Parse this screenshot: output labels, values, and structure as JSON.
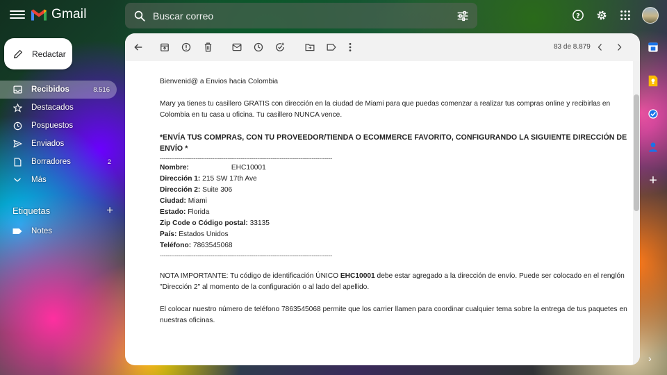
{
  "app": {
    "name": "Gmail"
  },
  "search": {
    "placeholder": "Buscar correo"
  },
  "compose": {
    "label": "Redactar"
  },
  "nav": [
    {
      "label": "Recibidos",
      "count": "8.516",
      "icon": "inbox-icon"
    },
    {
      "label": "Destacados",
      "count": "",
      "icon": "star-icon"
    },
    {
      "label": "Pospuestos",
      "count": "",
      "icon": "clock-icon"
    },
    {
      "label": "Enviados",
      "count": "",
      "icon": "send-icon"
    },
    {
      "label": "Borradores",
      "count": "2",
      "icon": "draft-icon"
    },
    {
      "label": "Más",
      "count": "",
      "icon": "chevron-down-icon"
    }
  ],
  "labels": {
    "title": "Etiquetas",
    "items": [
      {
        "label": "Notes"
      }
    ]
  },
  "toolbar": {
    "pager": "83 de 8.879"
  },
  "email": {
    "greeting": "Bienvenid@ a Envios hacia Colombia",
    "intro": "Mary ya tienes tu casillero GRATIS con dirección en la ciudad de Miami para que puedas comenzar a realizar tus compras online y recibirlas en Colombia en tu casa u oficina. Tu casillero NUNCA vence.",
    "headline": "*ENVÍA TUS COMPRAS, CON TU PROVEEDOR/TIENDA O ECOMMERCE FAVORITO, CONFIGURANDO LA SIGUIENTE DIRECCIÓN DE ENVÍO *",
    "divider": "--------------------------------------------------------------------------------------------",
    "address": {
      "name_label": "Nombre:",
      "name_value": "EHC10001",
      "dir1_label": "Dirección 1:",
      "dir1_value": "215 SW 17th Ave",
      "dir2_label": "Dirección 2:",
      "dir2_value": "Suite 306",
      "city_label": "Ciudad:",
      "city_value": "Miami",
      "state_label": "Estado:",
      "state_value": "Florida",
      "zip_label": "Zip Code o Código postal:",
      "zip_value": "33135",
      "country_label": "País:",
      "country_value": "Estados Unidos",
      "phone_label": "Teléfono:",
      "phone_value": "7863545068"
    },
    "note_prefix": "NOTA IMPORTANTE: Tu código de identificación ÚNICO ",
    "note_code": "EHC10001",
    "note_suffix": " debe estar agregado a la dirección de envío. Puede ser colocado en el renglón \"Dirección 2\" al momento de la configuración o al lado del apellido.",
    "phone_note": "El colocar nuestro número de teléfono 7863545068 permite que los carrier llamen para coordinar cualquier tema sobre la entrega de tus paquetes en nuestras oficinas."
  },
  "colors": {
    "gmail_red": "#ea4335",
    "calendar": "#1a73e8",
    "keep": "#fbbc04",
    "tasks": "#1a73e8",
    "contacts": "#1a73e8"
  }
}
